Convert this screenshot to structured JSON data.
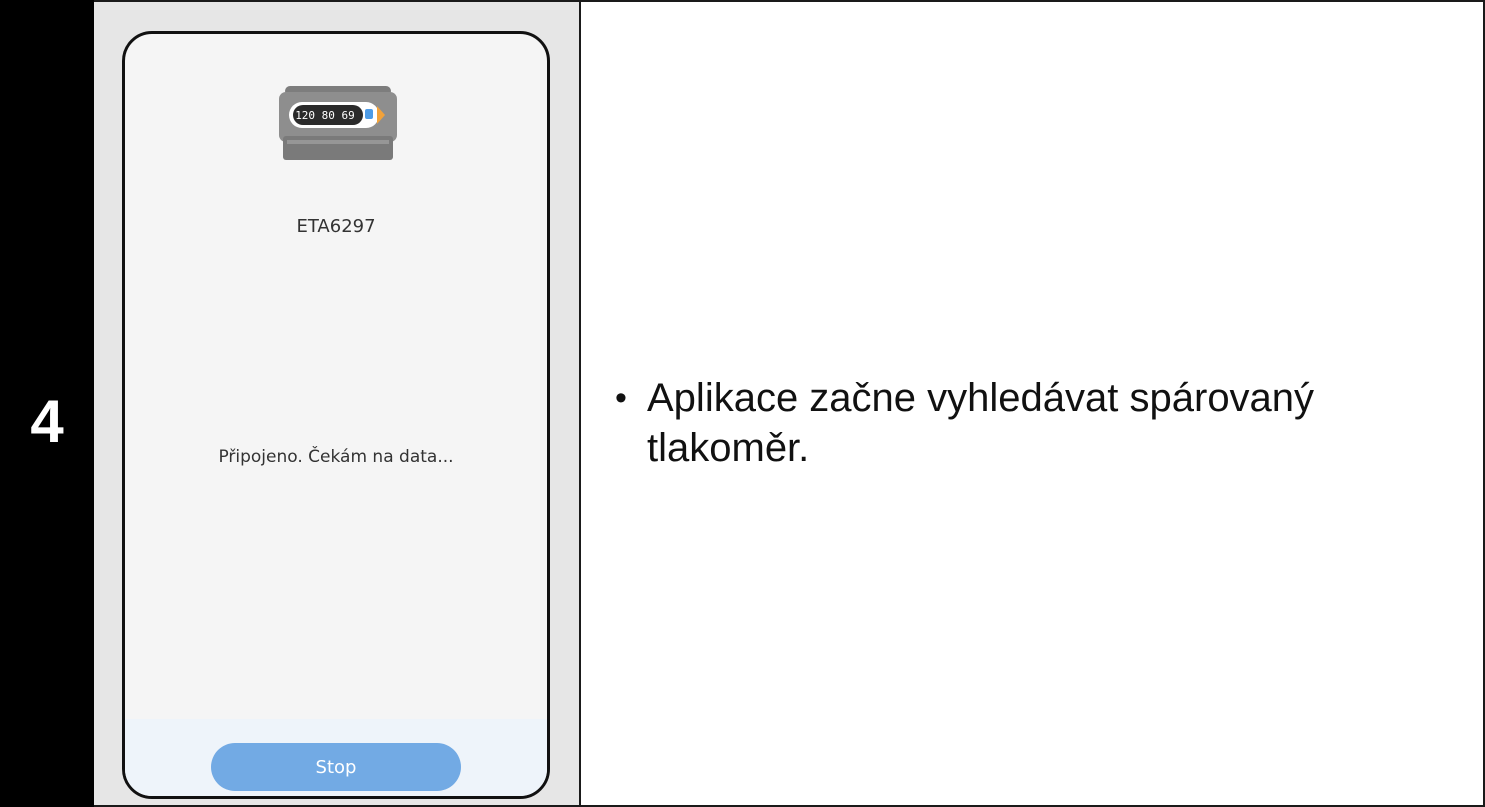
{
  "step": {
    "number": "4"
  },
  "phone": {
    "device_image": {
      "icon": "blood-pressure-monitor-icon",
      "display_readout": "120 80 69"
    },
    "model_name": "ETA6297",
    "status": "Připojeno. Čekám na data...",
    "stop_button": "Stop",
    "colors": {
      "button": "#72aae4",
      "screen_background": "#f5f5f5",
      "bottom_bar": "#eef4fa"
    }
  },
  "instruction": {
    "bullet": "•",
    "text": "Aplikace začne vyhledávat spárovaný tlakoměr."
  }
}
